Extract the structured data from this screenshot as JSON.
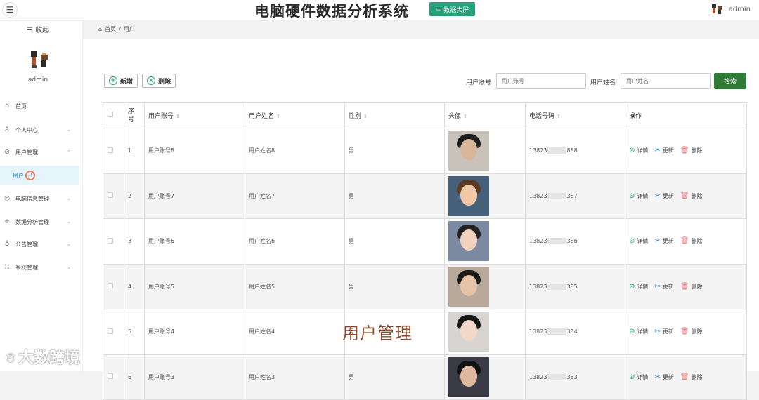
{
  "header": {
    "title": "电脑硬件数据分析系统",
    "big_screen_label": "数据大屏",
    "username": "admin"
  },
  "sidebar": {
    "collapse_label": "收起",
    "user_name": "admin",
    "items": [
      {
        "label": "首页",
        "icon": "home-icon"
      },
      {
        "label": "个人中心",
        "icon": "user-icon"
      },
      {
        "label": "用户管理",
        "icon": "user-manage-icon"
      },
      {
        "label": "用户",
        "icon": ""
      },
      {
        "label": "电脑信息管理",
        "icon": "computer-icon"
      },
      {
        "label": "数据分析管理",
        "icon": "sliders-icon"
      },
      {
        "label": "公告管理",
        "icon": "bulb-icon"
      },
      {
        "label": "系统管理",
        "icon": "expand-icon"
      }
    ]
  },
  "breadcrumb": {
    "home": "首页",
    "separator": "/",
    "current": "用户"
  },
  "toolbar": {
    "add_label": "新增",
    "delete_label": "删除"
  },
  "filters": {
    "account_label": "用户账号",
    "account_placeholder": "用户账号",
    "name_label": "用户姓名",
    "name_placeholder": "用户姓名",
    "search_label": "搜索"
  },
  "table": {
    "headers": [
      "序号",
      "用户账号",
      "用户姓名",
      "性别",
      "头像",
      "电话号码",
      "操作"
    ],
    "actions": {
      "detail": "详情",
      "update": "更新",
      "delete": "删除"
    },
    "rows": [
      {
        "index": "1",
        "account": "用户账号8",
        "name": "用户姓名8",
        "gender": "男",
        "phone_prefix": "13823",
        "phone_suffix": "888"
      },
      {
        "index": "2",
        "account": "用户账号7",
        "name": "用户姓名7",
        "gender": "男",
        "phone_prefix": "13823",
        "phone_suffix": "387"
      },
      {
        "index": "3",
        "account": "用户账号6",
        "name": "用户姓名6",
        "gender": "男",
        "phone_prefix": "13823",
        "phone_suffix": "386"
      },
      {
        "index": "4",
        "account": "用户账号5",
        "name": "用户姓名5",
        "gender": "男",
        "phone_prefix": "13823",
        "phone_suffix": "385"
      },
      {
        "index": "5",
        "account": "用户账号4",
        "name": "用户姓名4",
        "gender": "男",
        "phone_prefix": "13823",
        "phone_suffix": "384"
      },
      {
        "index": "6",
        "account": "用户账号3",
        "name": "用户姓名3",
        "gender": "男",
        "phone_prefix": "13823",
        "phone_suffix": "383"
      }
    ]
  },
  "overlay": {
    "caption": "用户管理",
    "watermark": "大数跨境"
  },
  "colors": {
    "accent": "#26a17a",
    "search": "#2f7a35",
    "active_nav_bg": "#e6f4fb"
  }
}
